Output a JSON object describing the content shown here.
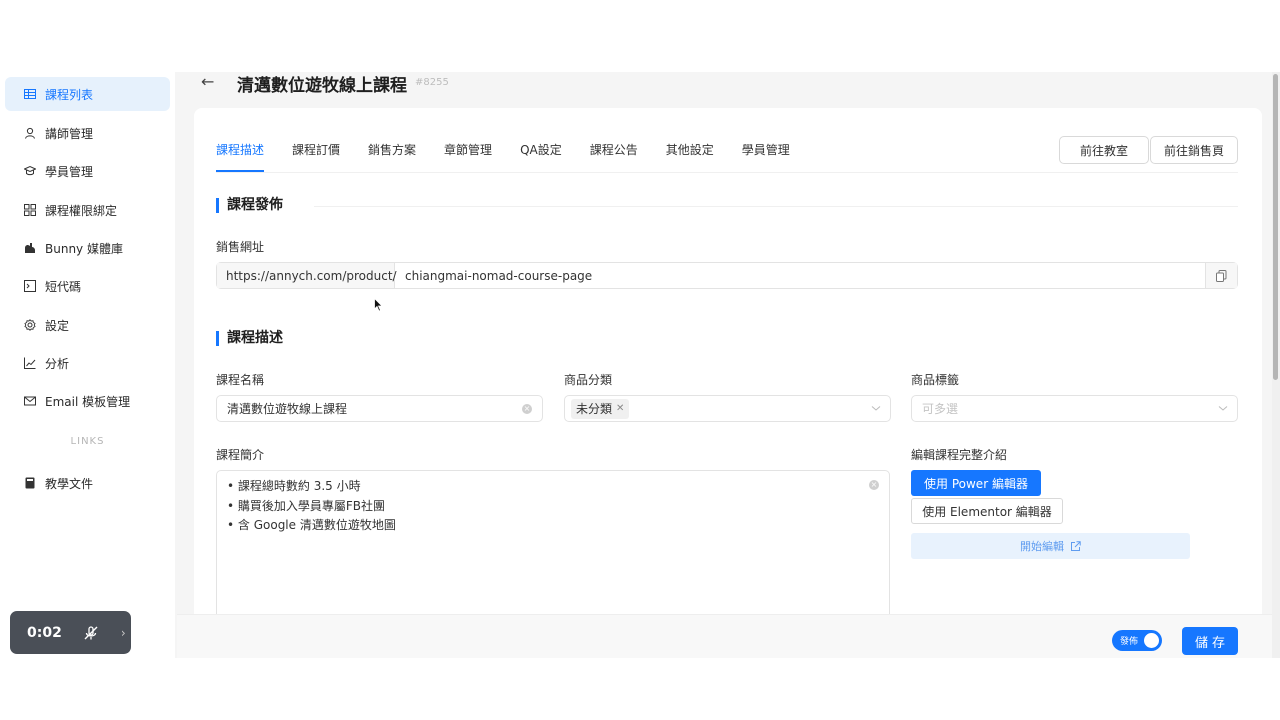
{
  "sidebar": {
    "items": [
      {
        "label": "課程列表",
        "icon": "table-icon",
        "active": true
      },
      {
        "label": "講師管理",
        "icon": "user-icon"
      },
      {
        "label": "學員管理",
        "icon": "graduation-icon"
      },
      {
        "label": "課程權限綁定",
        "icon": "grid-icon"
      },
      {
        "label": "Bunny 媒體庫",
        "icon": "rabbit-icon"
      },
      {
        "label": "短代碼",
        "icon": "code-icon"
      },
      {
        "label": "設定",
        "icon": "gear-icon"
      },
      {
        "label": "分析",
        "icon": "chart-icon"
      },
      {
        "label": "Email 模板管理",
        "icon": "mail-icon"
      }
    ],
    "group_label": "LINKS",
    "links": [
      {
        "label": "教學文件",
        "icon": "book-icon"
      }
    ]
  },
  "header": {
    "back_icon": "arrow-left-icon",
    "title": "清邁數位遊牧線上課程",
    "id": "#8255"
  },
  "tabs": [
    {
      "label": "課程描述",
      "active": true
    },
    {
      "label": "課程訂價"
    },
    {
      "label": "銷售方案"
    },
    {
      "label": "章節管理"
    },
    {
      "label": "QA設定"
    },
    {
      "label": "課程公告"
    },
    {
      "label": "其他設定"
    },
    {
      "label": "學員管理"
    }
  ],
  "actions": {
    "classroom": "前往教室",
    "sales_page": "前往銷售頁"
  },
  "publish_section": {
    "title": "課程發佈",
    "url_label": "銷售網址",
    "url_prefix": "https://annych.com/product/",
    "url_slug": "chiangmai-nomad-course-page",
    "copy_icon": "copy-icon"
  },
  "description_section": {
    "title": "課程描述",
    "name_label": "課程名稱",
    "name_value": "清邁數位遊牧線上課程",
    "category_label": "商品分類",
    "category_tag": "未分類",
    "tags_label": "商品標籤",
    "tags_placeholder": "可多選",
    "intro_label": "課程簡介",
    "intro_lines": [
      "• 課程總時數約 3.5 小時",
      "• 購買後加入學員專屬FB社團",
      "• 含 Google 清邁數位遊牧地圖"
    ],
    "full_intro_label": "編輯課程完整介紹",
    "power_editor_btn": "使用 Power 編輯器",
    "elementor_editor_btn": "使用 Elementor 編輯器",
    "start_edit_btn": "開始編輯"
  },
  "footer": {
    "publish_toggle_label": "發佈",
    "publish_on": true,
    "save_btn": "儲存"
  },
  "recorder": {
    "time": "0:02"
  },
  "colors": {
    "primary": "#1677ff",
    "active_bg": "#e6f1fc"
  }
}
